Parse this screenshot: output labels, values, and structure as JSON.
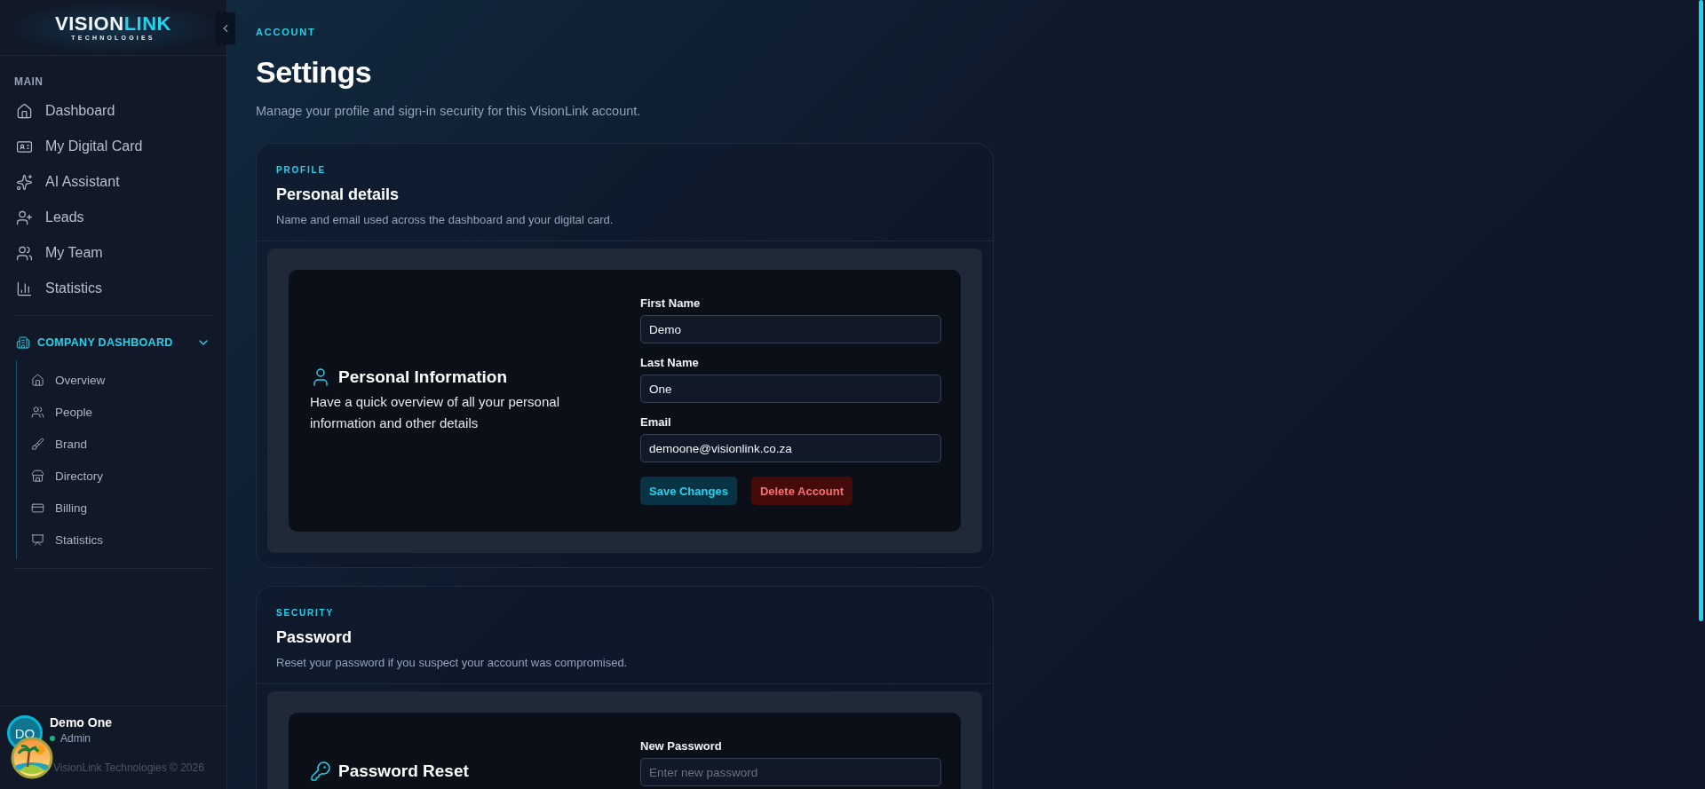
{
  "sidebar": {
    "logo": {
      "word_1": "VISION",
      "word_2": "LINK",
      "tagline": "TECHNOLOGIES"
    },
    "main_section": {
      "title": "MAIN",
      "items": [
        {
          "label": "Dashboard",
          "selected": false
        },
        {
          "label": "My Digital Card",
          "selected": false
        },
        {
          "label": "AI Assistant",
          "selected": false
        },
        {
          "label": "Leads",
          "selected": false
        },
        {
          "label": "My Team",
          "selected": false
        },
        {
          "label": "Statistics",
          "selected": false
        }
      ]
    },
    "company_section": {
      "title": "COMPANY DASHBOARD",
      "expanded": true,
      "items": [
        {
          "label": "Overview",
          "selected": false
        },
        {
          "label": "People",
          "selected": false
        },
        {
          "label": "Brand",
          "selected": false
        },
        {
          "label": "Directory",
          "selected": false
        },
        {
          "label": "Billing",
          "selected": false
        },
        {
          "label": "Statistics",
          "selected": false
        }
      ]
    },
    "user": {
      "initials": "DO",
      "name": "Demo One",
      "role": "Admin",
      "online": true
    },
    "copyright": "VisionLink Technologies © 2026"
  },
  "page": {
    "eyebrow": "ACCOUNT",
    "title": "Settings",
    "subtitle": "Manage your profile and sign-in security for this VisionLink account."
  },
  "sections": [
    {
      "eyebrow": "PROFILE",
      "title": "Personal details",
      "description": "Name and email used across the dashboard and your digital card.",
      "panel": {
        "title": "Personal Information",
        "description": "Have a quick overview of all your personal information and other details",
        "fields": [
          {
            "label": "First Name",
            "value": "Demo"
          },
          {
            "label": "Last Name",
            "value": "One"
          },
          {
            "label": "Email",
            "value": "demoone@visionlink.co.za"
          }
        ],
        "buttons": [
          {
            "label": "Save Changes",
            "kind": "primary"
          },
          {
            "label": "Delete Account",
            "kind": "danger"
          }
        ]
      }
    },
    {
      "eyebrow": "SECURITY",
      "title": "Password",
      "description": "Reset your password if you suspect your account was compromised.",
      "panel": {
        "title": "Password Reset",
        "fields": [
          {
            "label": "New Password",
            "placeholder": "Enter new password"
          }
        ]
      }
    }
  ]
}
